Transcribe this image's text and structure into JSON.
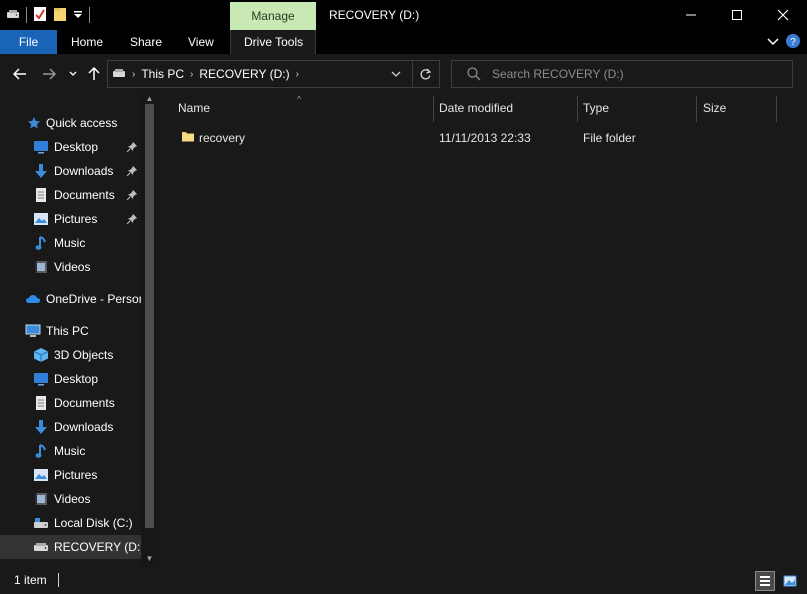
{
  "window": {
    "title": "RECOVERY (D:)",
    "contextual_tab_group": "Manage",
    "controls": {
      "minimize_icon": "minimize-icon",
      "maximize_icon": "maximize-icon",
      "close_icon": "close-icon"
    }
  },
  "ribbon": {
    "tabs": [
      {
        "label": "File"
      },
      {
        "label": "Home"
      },
      {
        "label": "Share"
      },
      {
        "label": "View"
      },
      {
        "label": "Drive Tools"
      }
    ],
    "accent_color": "#1a64b8",
    "contextual_color": "#c9e9b4"
  },
  "address": {
    "crumbs": [
      "This PC",
      "RECOVERY (D:)"
    ]
  },
  "search": {
    "placeholder": "Search RECOVERY (D:)"
  },
  "sidebar": {
    "quick_access": {
      "label": "Quick access",
      "items": [
        {
          "label": "Desktop",
          "icon": "desktop-icon",
          "pinned": true
        },
        {
          "label": "Downloads",
          "icon": "downloads-icon",
          "pinned": true
        },
        {
          "label": "Documents",
          "icon": "documents-icon",
          "pinned": true
        },
        {
          "label": "Pictures",
          "icon": "pictures-icon",
          "pinned": true
        },
        {
          "label": "Music",
          "icon": "music-icon",
          "pinned": false
        },
        {
          "label": "Videos",
          "icon": "videos-icon",
          "pinned": false
        }
      ]
    },
    "onedrive": {
      "label": "OneDrive - Person"
    },
    "this_pc": {
      "label": "This PC",
      "items": [
        {
          "label": "3D Objects",
          "icon": "3d-objects-icon"
        },
        {
          "label": "Desktop",
          "icon": "desktop-icon"
        },
        {
          "label": "Documents",
          "icon": "documents-icon"
        },
        {
          "label": "Downloads",
          "icon": "downloads-icon"
        },
        {
          "label": "Music",
          "icon": "music-icon"
        },
        {
          "label": "Pictures",
          "icon": "pictures-icon"
        },
        {
          "label": "Videos",
          "icon": "videos-icon"
        },
        {
          "label": "Local Disk (C:)",
          "icon": "local-disk-icon"
        },
        {
          "label": "RECOVERY (D:)",
          "icon": "drive-icon",
          "selected": true
        }
      ]
    }
  },
  "filelist": {
    "columns": [
      "Name",
      "Date modified",
      "Type",
      "Size"
    ],
    "rows": [
      {
        "name": "recovery",
        "date_modified": "11/11/2013 22:33",
        "type": "File folder",
        "size": ""
      }
    ]
  },
  "status": {
    "item_count": "1 item"
  }
}
